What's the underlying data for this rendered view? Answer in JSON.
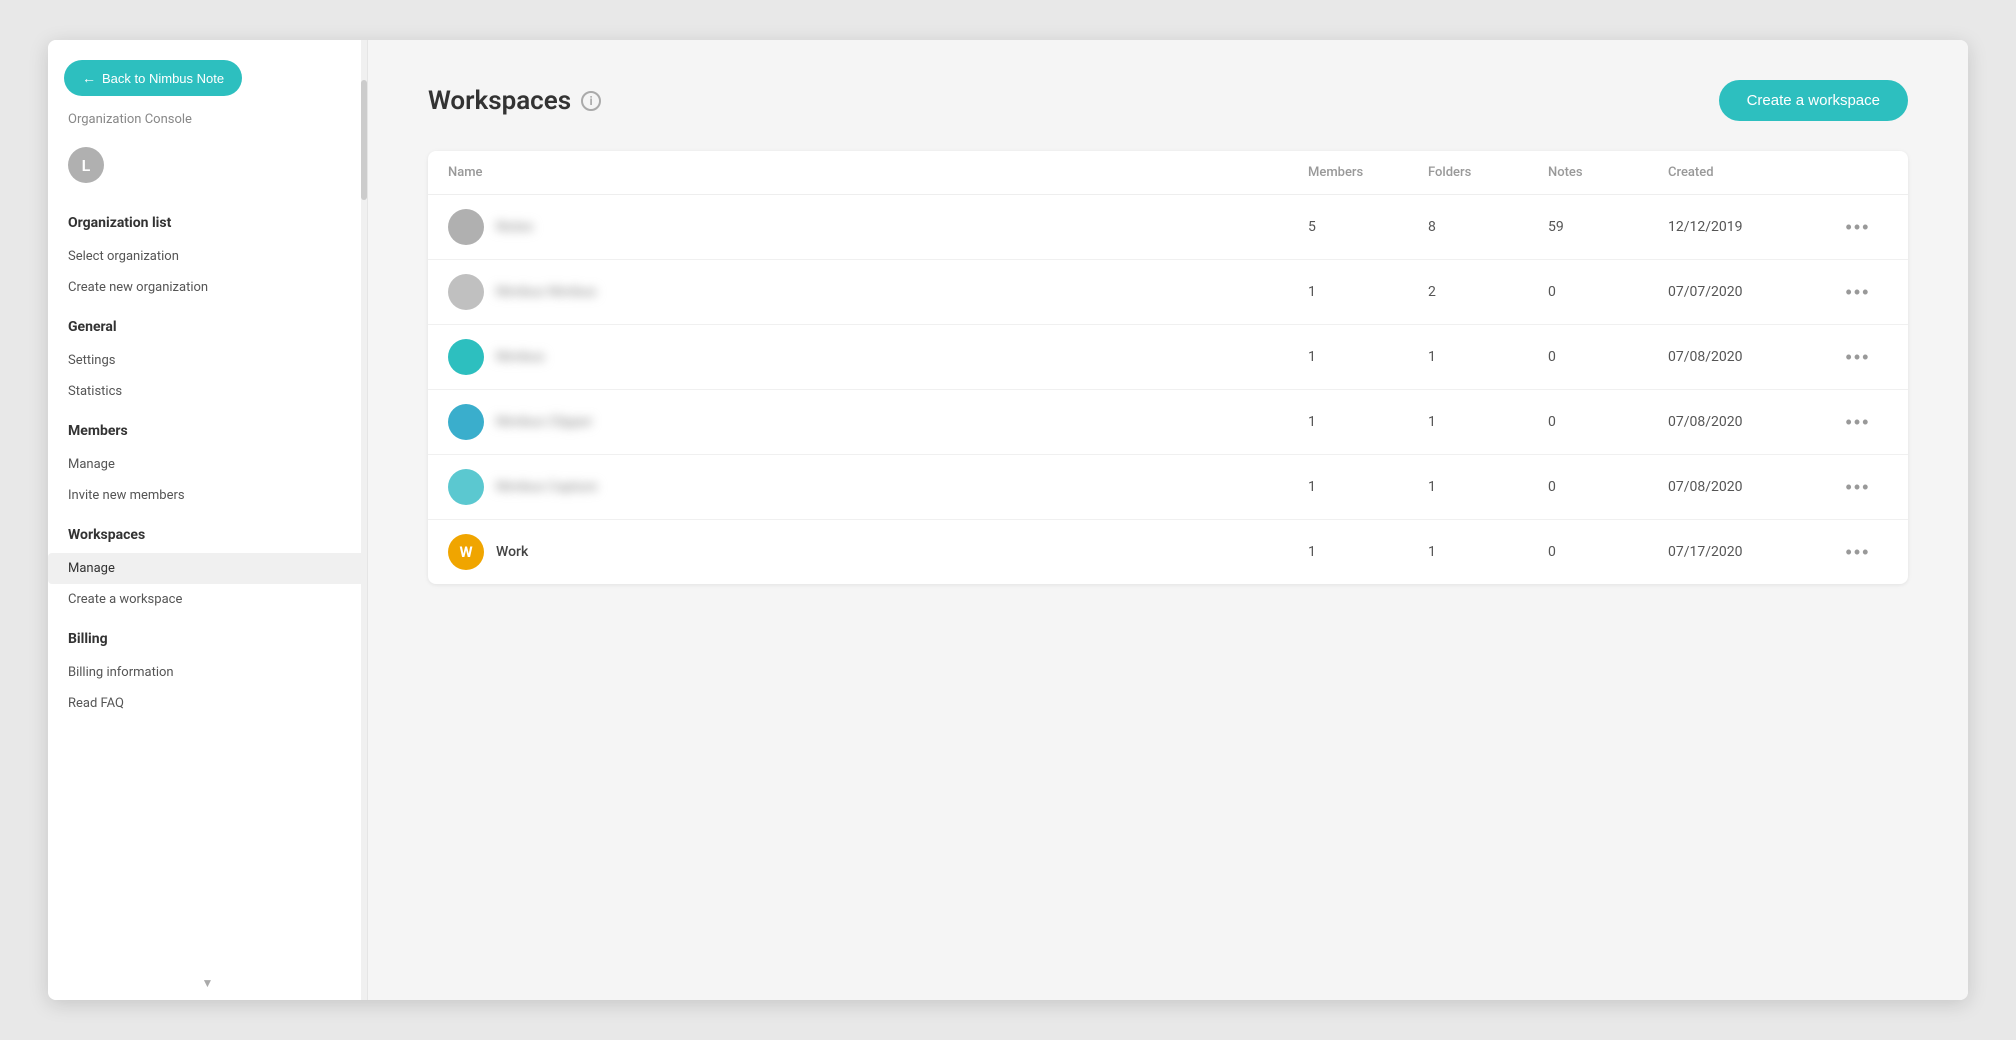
{
  "back_button": {
    "label": "Back to Nimbus Note",
    "arrow": "←"
  },
  "sidebar": {
    "org_console": "Organization Console",
    "user_initial": "L",
    "sections": [
      {
        "title": "Organization list",
        "items": [
          {
            "id": "select-org",
            "label": "Select organization",
            "active": false
          },
          {
            "id": "create-new-org",
            "label": "Create new organization",
            "active": false
          }
        ]
      },
      {
        "title": "General",
        "items": [
          {
            "id": "settings",
            "label": "Settings",
            "active": false
          },
          {
            "id": "statistics",
            "label": "Statistics",
            "active": false
          }
        ]
      },
      {
        "title": "Members",
        "items": [
          {
            "id": "members-manage",
            "label": "Manage",
            "active": false
          },
          {
            "id": "invite-members",
            "label": "Invite new members",
            "active": false
          }
        ]
      },
      {
        "title": "Workspaces",
        "items": [
          {
            "id": "workspaces-manage",
            "label": "Manage",
            "active": true
          },
          {
            "id": "create-workspace-link",
            "label": "Create a workspace",
            "active": false
          }
        ]
      },
      {
        "title": "Billing",
        "items": [
          {
            "id": "billing-info",
            "label": "Billing information",
            "active": false
          },
          {
            "id": "read-faq",
            "label": "Read FAQ",
            "active": false
          }
        ]
      }
    ]
  },
  "page": {
    "title": "Workspaces",
    "create_button_label": "Create a workspace"
  },
  "table": {
    "headers": [
      "Name",
      "Members",
      "Folders",
      "Notes",
      "Created",
      ""
    ],
    "rows": [
      {
        "id": "row-1",
        "avatar_color": "#b0b0b0",
        "avatar_text": "",
        "name": "Notes",
        "name_blurred": true,
        "members": "5",
        "folders": "8",
        "notes": "59",
        "created": "12/12/2019"
      },
      {
        "id": "row-2",
        "avatar_color": "#c0c0c0",
        "avatar_text": "",
        "name": "Nimbus Nimbus",
        "name_blurred": true,
        "members": "1",
        "folders": "2",
        "notes": "0",
        "created": "07/07/2020"
      },
      {
        "id": "row-3",
        "avatar_color": "#2dbfbf",
        "avatar_text": "",
        "name": "Nimbus",
        "name_blurred": true,
        "members": "1",
        "folders": "1",
        "notes": "0",
        "created": "07/08/2020"
      },
      {
        "id": "row-4",
        "avatar_color": "#3aaecc",
        "avatar_text": "",
        "name": "Nimbus Clipper",
        "name_blurred": true,
        "members": "1",
        "folders": "1",
        "notes": "0",
        "created": "07/08/2020"
      },
      {
        "id": "row-5",
        "avatar_color": "#5bc8d0",
        "avatar_text": "",
        "name": "Nimbus Capture",
        "name_blurred": true,
        "members": "1",
        "folders": "1",
        "notes": "0",
        "created": "07/08/2020"
      },
      {
        "id": "row-6",
        "avatar_color": "#f0a500",
        "avatar_text": "W",
        "name": "Work",
        "name_blurred": false,
        "members": "1",
        "folders": "1",
        "notes": "0",
        "created": "07/17/2020"
      }
    ]
  },
  "icons": {
    "more": "•••",
    "info": "i"
  }
}
